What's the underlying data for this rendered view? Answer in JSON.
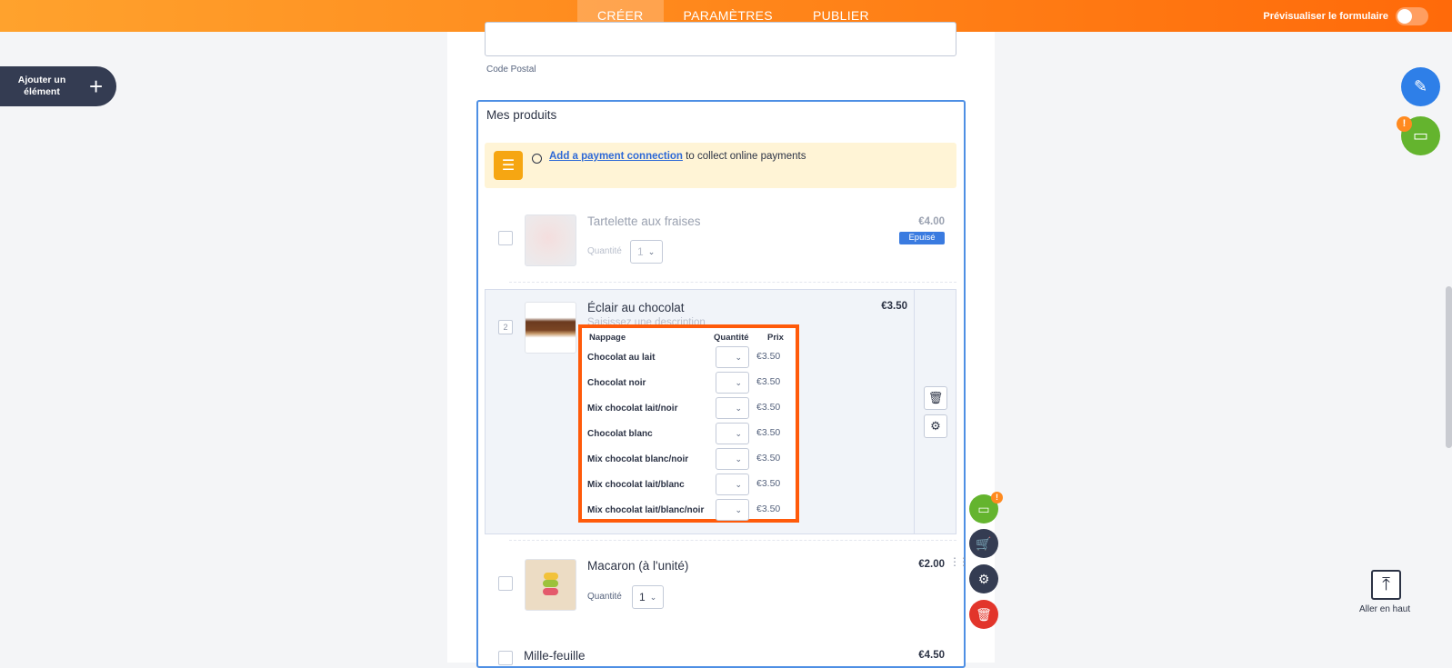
{
  "topbar": {
    "tabs": [
      "CRÉER",
      "PARAMÈTRES",
      "PUBLIER"
    ],
    "preview_label": "Prévisualiser le formulaire"
  },
  "sidebar": {
    "add_element_label": "Ajouter un élément"
  },
  "form": {
    "postal_label": "Code Postal",
    "products_title": "Mes produits",
    "notice": {
      "link_text": "Add a payment connection",
      "rest_text": " to collect online payments"
    },
    "quantity_label": "Quantité",
    "products": [
      {
        "name": "Tartelette aux fraises",
        "price": "€4.00",
        "badge": "Epuisé",
        "qty": "1"
      },
      {
        "name": "Éclair au chocolat",
        "price": "€3.50",
        "number": "2",
        "desc_placeholder": "Saisissez une description"
      },
      {
        "name": "Macaron (à l'unité)",
        "price": "€2.00",
        "qty": "1"
      },
      {
        "name": "Mille-feuille",
        "price": "€4.50"
      }
    ],
    "variants": {
      "headers": [
        "Nappage",
        "Quantité",
        "Prix"
      ],
      "rows": [
        {
          "name": "Chocolat au lait",
          "price": "€3.50"
        },
        {
          "name": "Chocolat noir",
          "price": "€3.50"
        },
        {
          "name": "Mix chocolat lait/noir",
          "price": "€3.50"
        },
        {
          "name": "Chocolat blanc",
          "price": "€3.50"
        },
        {
          "name": "Mix chocolat blanc/noir",
          "price": "€3.50"
        },
        {
          "name": "Mix chocolat lait/blanc",
          "price": "€3.50"
        },
        {
          "name": "Mix chocolat lait/blanc/noir",
          "price": "€3.50"
        }
      ]
    }
  },
  "right_tools": {
    "go_top_label": "Aller en haut",
    "alert_badge": "!"
  },
  "colors": {
    "accent_orange": "#ff7a14",
    "blue": "#2e7fe8",
    "green": "#64b42e",
    "dark": "#343c52",
    "red": "#e2352b"
  }
}
